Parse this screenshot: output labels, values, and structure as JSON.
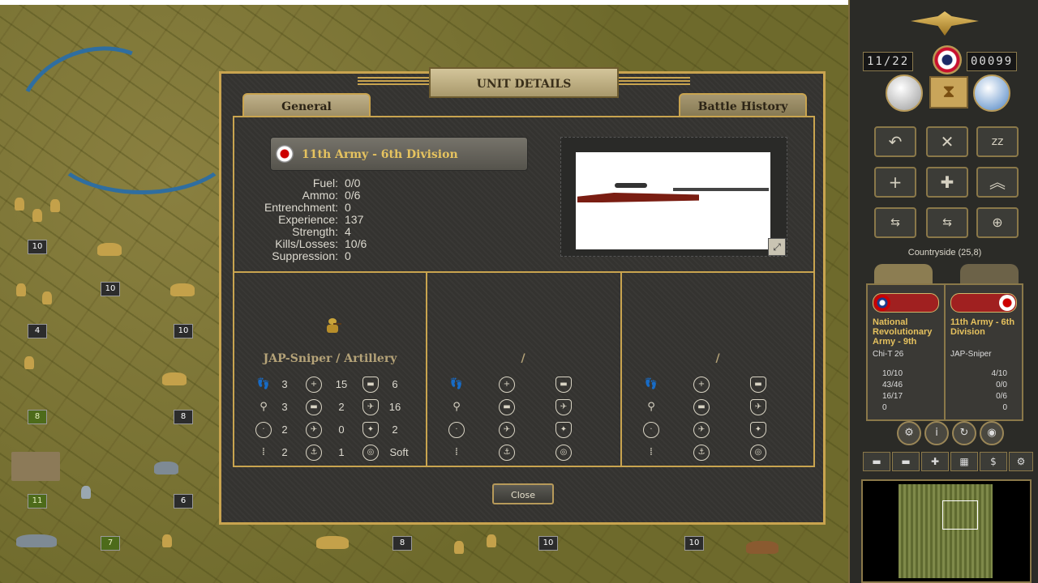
{
  "map": {
    "unit_badges": [
      "10",
      "10",
      "10",
      "4",
      "10",
      "8",
      "8",
      "11",
      "6",
      "7",
      "8",
      "10",
      "10"
    ]
  },
  "panel": {
    "turn_current": "11",
    "turn_total": "22",
    "prestige": "00099",
    "terrain_label": "Countryside (25,8)",
    "combat": {
      "left": {
        "name": "National Revolutionary Army - 9th",
        "type": "Chi-T 26",
        "stats": [
          "10/10",
          "43/46",
          "16/17",
          "0"
        ]
      },
      "right": {
        "name": "11th Army - 6th Division",
        "type": "JAP-Sniper",
        "stats": [
          "4/10",
          "0/0",
          "0/6",
          "0"
        ]
      }
    }
  },
  "dialog": {
    "title": "UNIT DETAILS",
    "tabs": {
      "general": "General",
      "history": "Battle History"
    },
    "unit_name": "11th Army - 6th Division",
    "stats": [
      {
        "label": "Fuel:",
        "value": "0/0"
      },
      {
        "label": "Ammo:",
        "value": "0/6"
      },
      {
        "label": "Entrenchment:",
        "value": "0"
      },
      {
        "label": "Experience:",
        "value": "137"
      },
      {
        "label": "Strength:",
        "value": "4"
      },
      {
        "label": "Kills/Losses:",
        "value": "10/6"
      },
      {
        "label": "Suppression:",
        "value": "0"
      }
    ],
    "columns": [
      {
        "name": "JAP-Sniper / Artillery",
        "values": [
          [
            "3",
            "15",
            "6"
          ],
          [
            "3",
            "2",
            "16"
          ],
          [
            "2",
            "0",
            "2"
          ],
          [
            "2",
            "1",
            "Soft"
          ]
        ]
      },
      {
        "name": "/",
        "values": [
          [
            "",
            "",
            ""
          ],
          [
            "",
            "",
            ""
          ],
          [
            "",
            "",
            ""
          ],
          [
            "",
            "",
            ""
          ]
        ]
      },
      {
        "name": "/",
        "values": [
          [
            "",
            "",
            ""
          ],
          [
            "",
            "",
            ""
          ],
          [
            "",
            "",
            ""
          ],
          [
            "",
            "",
            ""
          ]
        ]
      }
    ],
    "close_label": "Close"
  }
}
